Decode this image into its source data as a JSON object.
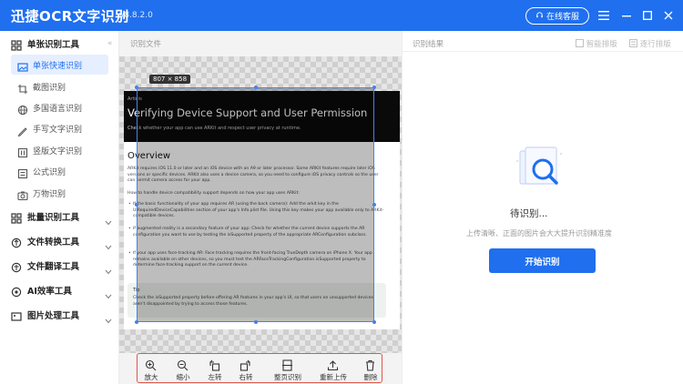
{
  "app": {
    "name": "迅捷OCR文字识别",
    "version": "v8.8.2.0",
    "support_label": "在线客服"
  },
  "icons": {
    "menu": "menu-icon",
    "minimize": "minimize-icon",
    "maximize": "maximize-icon",
    "close": "close-icon",
    "support": "headset-icon"
  },
  "colors": {
    "brand": "#1f6fef",
    "toolbar_highlight": "#e0574a",
    "active_bg": "#e6efff"
  },
  "sidebar": {
    "groups": [
      {
        "label": "单张识别工具",
        "expanded": true,
        "items": [
          {
            "label": "单张快速识别",
            "active": true,
            "icon": "image-scan-icon"
          },
          {
            "label": "截图识别",
            "icon": "screenshot-icon"
          },
          {
            "label": "多国语言识别",
            "icon": "globe-icon"
          },
          {
            "label": "手写文字识别",
            "icon": "handwriting-icon"
          },
          {
            "label": "竖版文字识别",
            "icon": "vertical-text-icon"
          },
          {
            "label": "公式识别",
            "icon": "formula-icon"
          },
          {
            "label": "万物识别",
            "icon": "camera-icon"
          }
        ]
      },
      {
        "label": "批量识别工具",
        "icon": "batch-icon"
      },
      {
        "label": "文件转换工具",
        "icon": "file-convert-icon"
      },
      {
        "label": "文件翻译工具",
        "icon": "translate-icon"
      },
      {
        "label": "AI效率工具",
        "icon": "ai-icon"
      },
      {
        "label": "图片处理工具",
        "icon": "image-tool-icon"
      }
    ]
  },
  "left_panel": {
    "title": "识别文件",
    "image_size_label": "807 × 858"
  },
  "document": {
    "kicker": "Article",
    "title": "Verifying Device Support and User Permission",
    "subtitle": "Check whether your app can use ARKit and respect user privacy at runtime.",
    "h2": "Overview",
    "p1": "ARKit requires iOS 11.0 or later and an iOS device with an A9 or later processor. Some ARKit features require later iOS versions or specific devices. ARKit also uses a device camera, so you need to configure iOS privacy controls so the user can permit camera access for your app.",
    "p2": "How to handle device compatibility support depends on how your app uses ARKit:",
    "b1": "If the basic functionality of your app requires AR (using the back camera): Add the arkit key in the UIRequiredDeviceCapabilities section of your app's Info.plist file. Using this key makes your app available only to ARKit-compatible devices.",
    "b2": "If augmented reality is a secondary feature of your app: Check for whether the current device supports the AR configuration you want to use by testing the isSupported property of the appropriate ARConfiguration subclass.",
    "b3": "If your app uses face-tracking AR: Face tracking requires the front-facing TrueDepth camera on iPhone X. Your app remains available on other devices, so you must test the ARFaceTrackingConfiguration.isSupported property to determine face-tracking support on the current device.",
    "tip_label": "Tip",
    "tip_text": "Check the isSupported property before offering AR features in your app's UI, so that users on unsupported devices aren't disappointed by trying to access those features."
  },
  "toolbar": [
    {
      "label": "放大",
      "icon": "zoom-in-icon"
    },
    {
      "label": "缩小",
      "icon": "zoom-out-icon"
    },
    {
      "label": "左转",
      "icon": "rotate-left-icon"
    },
    {
      "label": "右转",
      "icon": "rotate-right-icon"
    },
    {
      "label": "整页识别",
      "icon": "full-page-icon"
    },
    {
      "label": "重新上传",
      "icon": "upload-icon"
    },
    {
      "label": "删除",
      "icon": "delete-icon"
    }
  ],
  "right_panel": {
    "title": "识别结果",
    "smart_layout_label": "智能排版",
    "line_layout_label": "逐行排版",
    "empty_title": "待识别...",
    "empty_hint": "上传清晰、正面的图片会大大提升识别精准度",
    "start_label": "开始识别"
  }
}
